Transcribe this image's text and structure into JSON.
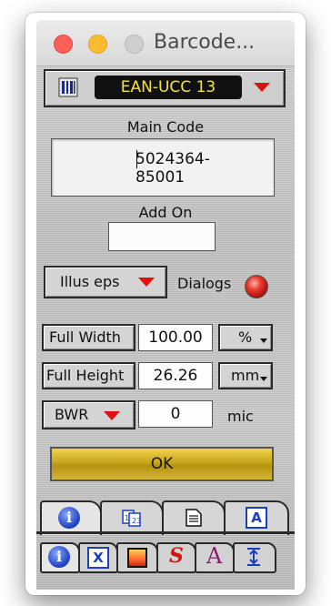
{
  "window": {
    "title": "Barcode...",
    "controls": [
      "close",
      "minimize",
      "zoom"
    ]
  },
  "symbology": {
    "icon": "barcode-bars-icon",
    "selected": "EAN-UCC 13",
    "dropdown_icon": "red-triangle-down-icon",
    "colors": {
      "display_bg": "#111111",
      "display_text": "#f6e43a",
      "arrow": "#e01010"
    }
  },
  "main_code": {
    "label": "Main Code",
    "value": "5024364-85001"
  },
  "add_on": {
    "label": "Add On",
    "value": ""
  },
  "format": {
    "selected": "Illus eps",
    "dialogs_label": "Dialogs",
    "dialogs_indicator_color": "#e8392b"
  },
  "dimensions": {
    "width_button": "Full Width",
    "width_value": "100.00",
    "width_unit": "%",
    "height_button": "Full Height",
    "height_value": "26.26",
    "height_unit": "mm",
    "bwr_button": "BWR",
    "bwr_value": "0",
    "bwr_unit": "mic"
  },
  "ok_button": {
    "label": "OK",
    "color": "#c9a61c"
  },
  "tabs_row1": [
    "info-icon",
    "numbers-icon",
    "document-icon",
    "text-frame-icon"
  ],
  "tabs_row2": [
    "info-icon",
    "x-box-icon",
    "gradient-icon",
    "red-s-icon",
    "letter-a-icon",
    "vertical-spacing-icon"
  ]
}
